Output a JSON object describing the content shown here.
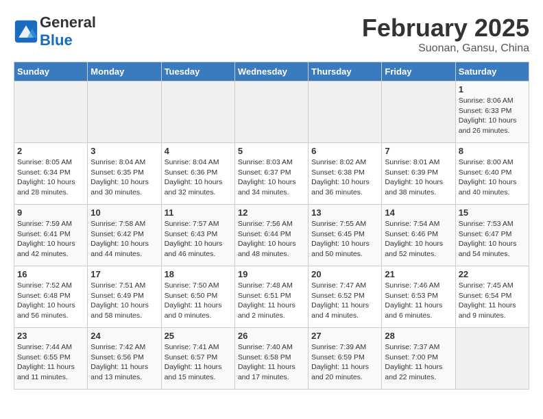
{
  "logo": {
    "general": "General",
    "blue": "Blue"
  },
  "calendar": {
    "title": "February 2025",
    "subtitle": "Suonan, Gansu, China"
  },
  "weekdays": [
    "Sunday",
    "Monday",
    "Tuesday",
    "Wednesday",
    "Thursday",
    "Friday",
    "Saturday"
  ],
  "weeks": [
    [
      {
        "day": "",
        "info": ""
      },
      {
        "day": "",
        "info": ""
      },
      {
        "day": "",
        "info": ""
      },
      {
        "day": "",
        "info": ""
      },
      {
        "day": "",
        "info": ""
      },
      {
        "day": "",
        "info": ""
      },
      {
        "day": "1",
        "info": "Sunrise: 8:06 AM\nSunset: 6:33 PM\nDaylight: 10 hours and 26 minutes."
      }
    ],
    [
      {
        "day": "2",
        "info": "Sunrise: 8:05 AM\nSunset: 6:34 PM\nDaylight: 10 hours and 28 minutes."
      },
      {
        "day": "3",
        "info": "Sunrise: 8:04 AM\nSunset: 6:35 PM\nDaylight: 10 hours and 30 minutes."
      },
      {
        "day": "4",
        "info": "Sunrise: 8:04 AM\nSunset: 6:36 PM\nDaylight: 10 hours and 32 minutes."
      },
      {
        "day": "5",
        "info": "Sunrise: 8:03 AM\nSunset: 6:37 PM\nDaylight: 10 hours and 34 minutes."
      },
      {
        "day": "6",
        "info": "Sunrise: 8:02 AM\nSunset: 6:38 PM\nDaylight: 10 hours and 36 minutes."
      },
      {
        "day": "7",
        "info": "Sunrise: 8:01 AM\nSunset: 6:39 PM\nDaylight: 10 hours and 38 minutes."
      },
      {
        "day": "8",
        "info": "Sunrise: 8:00 AM\nSunset: 6:40 PM\nDaylight: 10 hours and 40 minutes."
      }
    ],
    [
      {
        "day": "9",
        "info": "Sunrise: 7:59 AM\nSunset: 6:41 PM\nDaylight: 10 hours and 42 minutes."
      },
      {
        "day": "10",
        "info": "Sunrise: 7:58 AM\nSunset: 6:42 PM\nDaylight: 10 hours and 44 minutes."
      },
      {
        "day": "11",
        "info": "Sunrise: 7:57 AM\nSunset: 6:43 PM\nDaylight: 10 hours and 46 minutes."
      },
      {
        "day": "12",
        "info": "Sunrise: 7:56 AM\nSunset: 6:44 PM\nDaylight: 10 hours and 48 minutes."
      },
      {
        "day": "13",
        "info": "Sunrise: 7:55 AM\nSunset: 6:45 PM\nDaylight: 10 hours and 50 minutes."
      },
      {
        "day": "14",
        "info": "Sunrise: 7:54 AM\nSunset: 6:46 PM\nDaylight: 10 hours and 52 minutes."
      },
      {
        "day": "15",
        "info": "Sunrise: 7:53 AM\nSunset: 6:47 PM\nDaylight: 10 hours and 54 minutes."
      }
    ],
    [
      {
        "day": "16",
        "info": "Sunrise: 7:52 AM\nSunset: 6:48 PM\nDaylight: 10 hours and 56 minutes."
      },
      {
        "day": "17",
        "info": "Sunrise: 7:51 AM\nSunset: 6:49 PM\nDaylight: 10 hours and 58 minutes."
      },
      {
        "day": "18",
        "info": "Sunrise: 7:50 AM\nSunset: 6:50 PM\nDaylight: 11 hours and 0 minutes."
      },
      {
        "day": "19",
        "info": "Sunrise: 7:48 AM\nSunset: 6:51 PM\nDaylight: 11 hours and 2 minutes."
      },
      {
        "day": "20",
        "info": "Sunrise: 7:47 AM\nSunset: 6:52 PM\nDaylight: 11 hours and 4 minutes."
      },
      {
        "day": "21",
        "info": "Sunrise: 7:46 AM\nSunset: 6:53 PM\nDaylight: 11 hours and 6 minutes."
      },
      {
        "day": "22",
        "info": "Sunrise: 7:45 AM\nSunset: 6:54 PM\nDaylight: 11 hours and 9 minutes."
      }
    ],
    [
      {
        "day": "23",
        "info": "Sunrise: 7:44 AM\nSunset: 6:55 PM\nDaylight: 11 hours and 11 minutes."
      },
      {
        "day": "24",
        "info": "Sunrise: 7:42 AM\nSunset: 6:56 PM\nDaylight: 11 hours and 13 minutes."
      },
      {
        "day": "25",
        "info": "Sunrise: 7:41 AM\nSunset: 6:57 PM\nDaylight: 11 hours and 15 minutes."
      },
      {
        "day": "26",
        "info": "Sunrise: 7:40 AM\nSunset: 6:58 PM\nDaylight: 11 hours and 17 minutes."
      },
      {
        "day": "27",
        "info": "Sunrise: 7:39 AM\nSunset: 6:59 PM\nDaylight: 11 hours and 20 minutes."
      },
      {
        "day": "28",
        "info": "Sunrise: 7:37 AM\nSunset: 7:00 PM\nDaylight: 11 hours and 22 minutes."
      },
      {
        "day": "",
        "info": ""
      }
    ]
  ]
}
